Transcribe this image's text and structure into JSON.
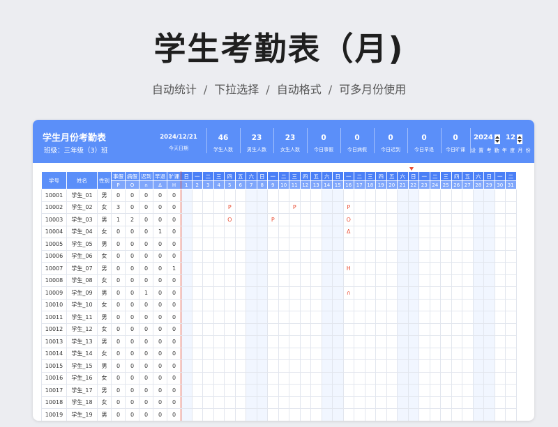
{
  "page": {
    "title": "学生考勤表（月)",
    "features": [
      "自动统计",
      "下拉选择",
      "自动格式",
      "可多月份使用"
    ],
    "separator": "/"
  },
  "header": {
    "title": "学生月份考勤表",
    "class_label": "班级：三年级（3）班",
    "stats": [
      {
        "value": "2024/12/21",
        "label": "今天日期"
      },
      {
        "value": "46",
        "label": "学生人数"
      },
      {
        "value": "23",
        "label": "男生人数"
      },
      {
        "value": "23",
        "label": "女生人数"
      },
      {
        "value": "0",
        "label": "今日事假"
      },
      {
        "value": "0",
        "label": "今日病假"
      },
      {
        "value": "0",
        "label": "今日迟到"
      },
      {
        "value": "0",
        "label": "今日早退"
      },
      {
        "value": "0",
        "label": "今日旷课"
      }
    ],
    "year": "2024",
    "month": "12",
    "control_label": "设 置 考 勤 年 度 月 份"
  },
  "table": {
    "col_id": "学号",
    "col_name": "姓名",
    "col_gender": "性别",
    "types": [
      {
        "name": "事假",
        "symbol": "P"
      },
      {
        "name": "病假",
        "symbol": "O"
      },
      {
        "name": "迟到",
        "symbol": "∩"
      },
      {
        "name": "早退",
        "symbol": "Δ"
      },
      {
        "name": "旷课",
        "symbol": "H"
      }
    ],
    "weekdays": [
      "日",
      "一",
      "二",
      "三",
      "四",
      "五",
      "六",
      "日",
      "一",
      "二",
      "三",
      "四",
      "五",
      "六",
      "日",
      "一",
      "二",
      "三",
      "四",
      "五",
      "六",
      "日",
      "一",
      "二",
      "三",
      "四",
      "五",
      "六",
      "日",
      "一",
      "二"
    ],
    "days": [
      1,
      2,
      3,
      4,
      5,
      6,
      7,
      8,
      9,
      10,
      11,
      12,
      13,
      14,
      15,
      16,
      17,
      18,
      19,
      20,
      21,
      22,
      23,
      24,
      25,
      26,
      27,
      28,
      29,
      30,
      31
    ],
    "weekend_days": [
      1,
      7,
      8,
      14,
      15,
      21,
      22,
      28,
      29
    ],
    "today_day": 21,
    "rows": [
      {
        "id": "10001",
        "name": "学生_01",
        "gender": "男",
        "counts": [
          0,
          0,
          0,
          0,
          0
        ],
        "marks": {}
      },
      {
        "id": "10002",
        "name": "学生_02",
        "gender": "女",
        "counts": [
          3,
          0,
          0,
          0,
          0
        ],
        "marks": {
          "5": "P",
          "11": "P",
          "16": "P"
        }
      },
      {
        "id": "10003",
        "name": "学生_03",
        "gender": "男",
        "counts": [
          1,
          2,
          0,
          0,
          0
        ],
        "marks": {
          "5": "O",
          "9": "P",
          "16": "O"
        }
      },
      {
        "id": "10004",
        "name": "学生_04",
        "gender": "女",
        "counts": [
          0,
          0,
          0,
          1,
          0
        ],
        "marks": {
          "16": "Δ"
        }
      },
      {
        "id": "10005",
        "name": "学生_05",
        "gender": "男",
        "counts": [
          0,
          0,
          0,
          0,
          0
        ],
        "marks": {}
      },
      {
        "id": "10006",
        "name": "学生_06",
        "gender": "女",
        "counts": [
          0,
          0,
          0,
          0,
          0
        ],
        "marks": {}
      },
      {
        "id": "10007",
        "name": "学生_07",
        "gender": "男",
        "counts": [
          0,
          0,
          0,
          0,
          1
        ],
        "marks": {
          "16": "H"
        }
      },
      {
        "id": "10008",
        "name": "学生_08",
        "gender": "女",
        "counts": [
          0,
          0,
          0,
          0,
          0
        ],
        "marks": {}
      },
      {
        "id": "10009",
        "name": "学生_09",
        "gender": "男",
        "counts": [
          0,
          0,
          1,
          0,
          0
        ],
        "marks": {
          "16": "∩"
        }
      },
      {
        "id": "10010",
        "name": "学生_10",
        "gender": "女",
        "counts": [
          0,
          0,
          0,
          0,
          0
        ],
        "marks": {}
      },
      {
        "id": "10011",
        "name": "学生_11",
        "gender": "男",
        "counts": [
          0,
          0,
          0,
          0,
          0
        ],
        "marks": {}
      },
      {
        "id": "10012",
        "name": "学生_12",
        "gender": "女",
        "counts": [
          0,
          0,
          0,
          0,
          0
        ],
        "marks": {}
      },
      {
        "id": "10013",
        "name": "学生_13",
        "gender": "男",
        "counts": [
          0,
          0,
          0,
          0,
          0
        ],
        "marks": {}
      },
      {
        "id": "10014",
        "name": "学生_14",
        "gender": "女",
        "counts": [
          0,
          0,
          0,
          0,
          0
        ],
        "marks": {}
      },
      {
        "id": "10015",
        "name": "学生_15",
        "gender": "男",
        "counts": [
          0,
          0,
          0,
          0,
          0
        ],
        "marks": {}
      },
      {
        "id": "10016",
        "name": "学生_16",
        "gender": "女",
        "counts": [
          0,
          0,
          0,
          0,
          0
        ],
        "marks": {}
      },
      {
        "id": "10017",
        "name": "学生_17",
        "gender": "男",
        "counts": [
          0,
          0,
          0,
          0,
          0
        ],
        "marks": {}
      },
      {
        "id": "10018",
        "name": "学生_18",
        "gender": "女",
        "counts": [
          0,
          0,
          0,
          0,
          0
        ],
        "marks": {}
      },
      {
        "id": "10019",
        "name": "学生_19",
        "gender": "男",
        "counts": [
          0,
          0,
          0,
          0,
          0
        ],
        "marks": {}
      }
    ]
  },
  "colors": {
    "accent": "#5b8ff9",
    "mark": "#e8492f",
    "weekend": "#f1f6ff"
  }
}
